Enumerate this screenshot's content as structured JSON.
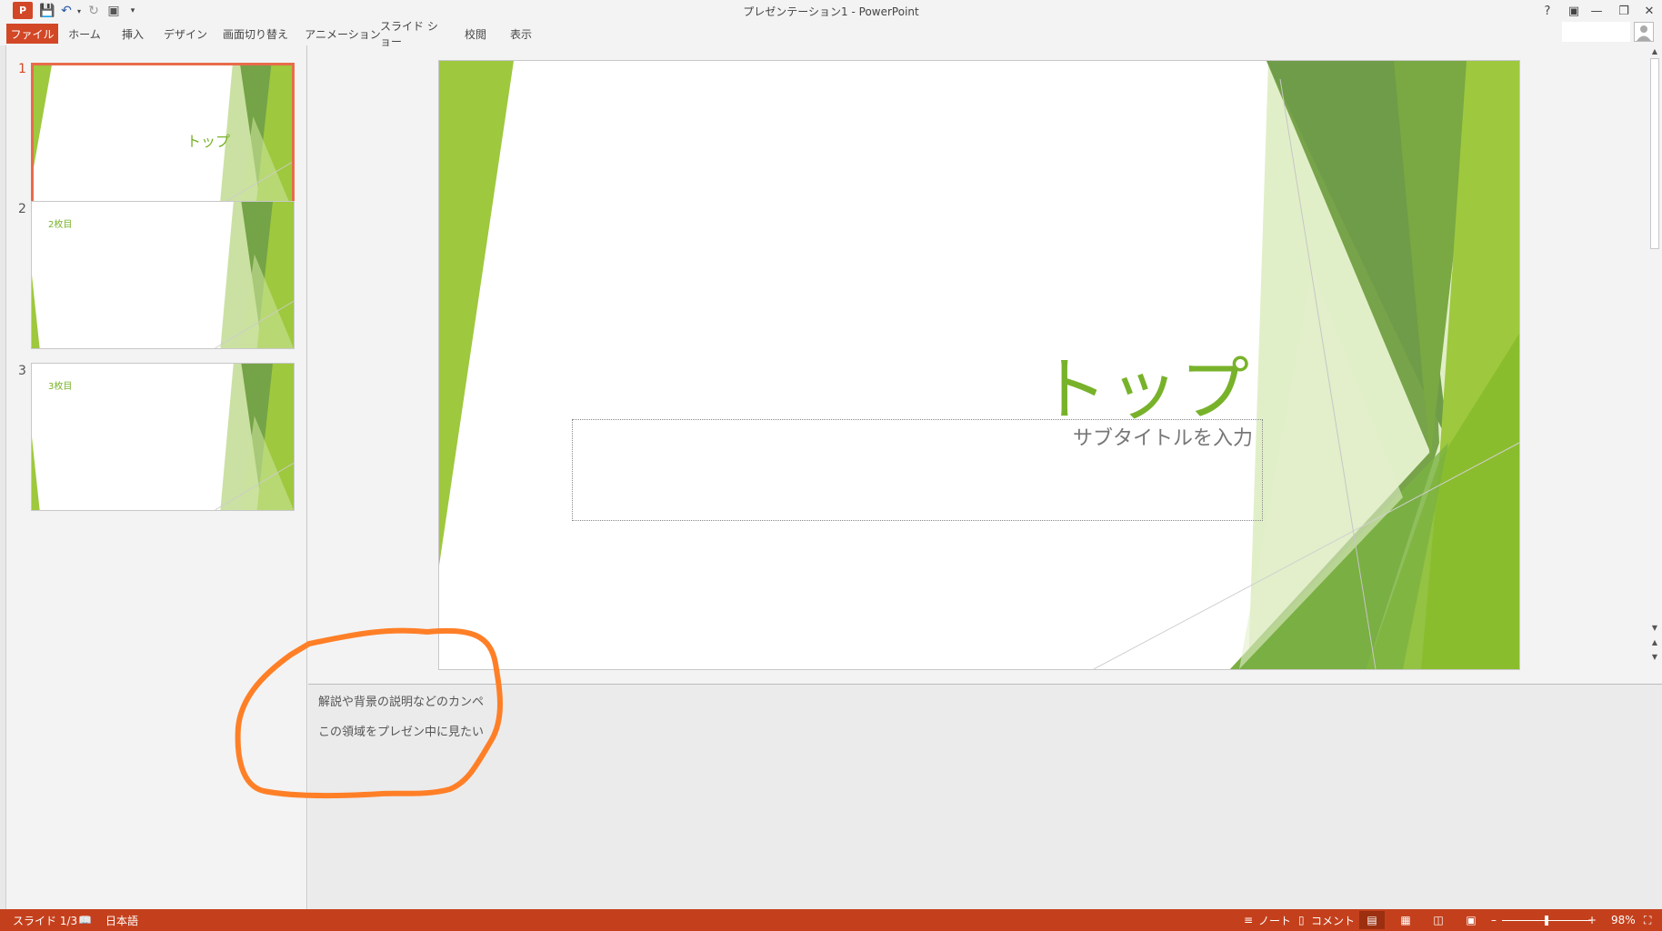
{
  "window": {
    "title": "プレゼンテーション1 - PowerPoint",
    "logo_text": "P",
    "controls": [
      "?",
      "▣",
      "—",
      "❐",
      "✕"
    ]
  },
  "ribbon": {
    "tabs": [
      "ファイル",
      "ホーム",
      "挿入",
      "デザイン",
      "画面切り替え",
      "アニメーション",
      "スライド ショー",
      "校閲",
      "表示"
    ]
  },
  "slides": [
    {
      "number": "1",
      "title": "トップ",
      "selected": true
    },
    {
      "number": "2",
      "title": "2枚目",
      "selected": false
    },
    {
      "number": "3",
      "title": "3枚目",
      "selected": false
    }
  ],
  "current_slide": {
    "title": "トップ",
    "subtitle_placeholder": "サブタイトルを入力"
  },
  "notes": {
    "lines": [
      "解説や背景の説明などのカンペ",
      "この領域をプレゼン中に見たい"
    ]
  },
  "status": {
    "slide_indicator": "スライド 1/3",
    "language": "日本語",
    "notes_label": "ノート",
    "comments_label": "コメント",
    "zoom_percent": "98%",
    "zoom_level": 0.5
  },
  "colors": {
    "accent": "#d24726",
    "status_bar": "#c4401c",
    "title_green": "#78b22a",
    "annotation": "#ff7f27"
  }
}
